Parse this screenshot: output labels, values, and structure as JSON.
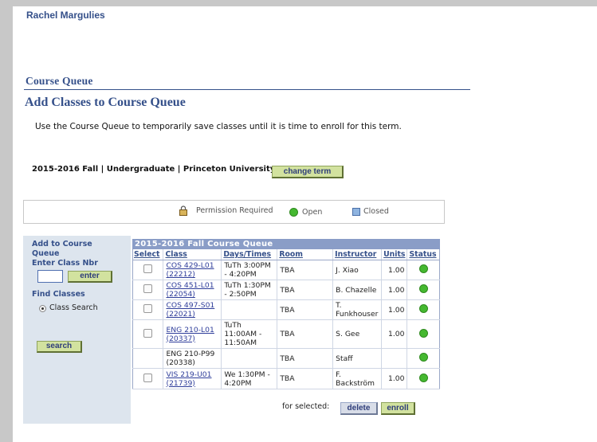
{
  "user": {
    "name": "Rachel Margulies"
  },
  "section_title": "Course Queue",
  "page_title": "Add Classes to Course Queue",
  "intro": "Use the Course Queue to temporarily save classes until it is time to enroll for this term.",
  "term": {
    "info": "2015-2016 Fall | Undergraduate | Princeton University",
    "change_label": "change term"
  },
  "legend": {
    "permission": "Permission Required",
    "open": "Open",
    "closed": "Closed"
  },
  "left_panel": {
    "add_label": "Add to Course Queue",
    "enter_nbr_label": "Enter Class Nbr",
    "enter_button": "enter",
    "find_label": "Find Classes",
    "radio_label": "Class Search",
    "search_button": "search"
  },
  "queue": {
    "title": "2015-2016 Fall Course Queue",
    "columns": [
      "Select",
      "Class",
      "Days/Times",
      "Room",
      "Instructor",
      "Units",
      "Status"
    ],
    "rows": [
      {
        "selectable": true,
        "class_line1": "COS 429-L01",
        "class_line2": "(22212)",
        "linked": true,
        "days_times": "TuTh 3:00PM - 4:20PM",
        "room": "TBA",
        "instructor": "J. Xiao",
        "units": "1.00",
        "status": "open"
      },
      {
        "selectable": true,
        "class_line1": "COS 451-L01",
        "class_line2": "(22054)",
        "linked": true,
        "days_times": "TuTh 1:30PM - 2:50PM",
        "room": "TBA",
        "instructor": "B. Chazelle",
        "units": "1.00",
        "status": "open"
      },
      {
        "selectable": true,
        "class_line1": "COS 497-S01",
        "class_line2": "(22021)",
        "linked": true,
        "days_times": "",
        "room": "TBA",
        "instructor": "T. Funkhouser",
        "units": "1.00",
        "status": "open"
      },
      {
        "selectable": true,
        "class_line1": "ENG 210-L01",
        "class_line2": "(20337)",
        "linked": true,
        "days_times": "TuTh 11:00AM - 11:50AM",
        "room": "TBA",
        "instructor": "S. Gee",
        "units": "1.00",
        "status": "open"
      },
      {
        "selectable": false,
        "class_line1": "ENG 210-P99",
        "class_line2": "(20338)",
        "linked": false,
        "days_times": "",
        "room": "TBA",
        "instructor": "Staff",
        "units": "",
        "status": "open"
      },
      {
        "selectable": true,
        "class_line1": "VIS 219-U01",
        "class_line2": "(21739)",
        "linked": true,
        "days_times": "We 1:30PM - 4:20PM",
        "room": "TBA",
        "instructor": "F. Backström",
        "units": "1.00",
        "status": "open"
      }
    ],
    "for_selected_label": "for selected:",
    "delete_button": "delete",
    "enroll_button": "enroll"
  },
  "colors": {
    "heading": "#35508a",
    "open": "#45b830",
    "closed": "#8fb4e0",
    "button": "#d2e29f",
    "queue_header": "#8a9dc7"
  },
  "icons": {
    "permission": "lock-icon",
    "open": "green-circle-icon",
    "closed": "blue-square-icon"
  }
}
